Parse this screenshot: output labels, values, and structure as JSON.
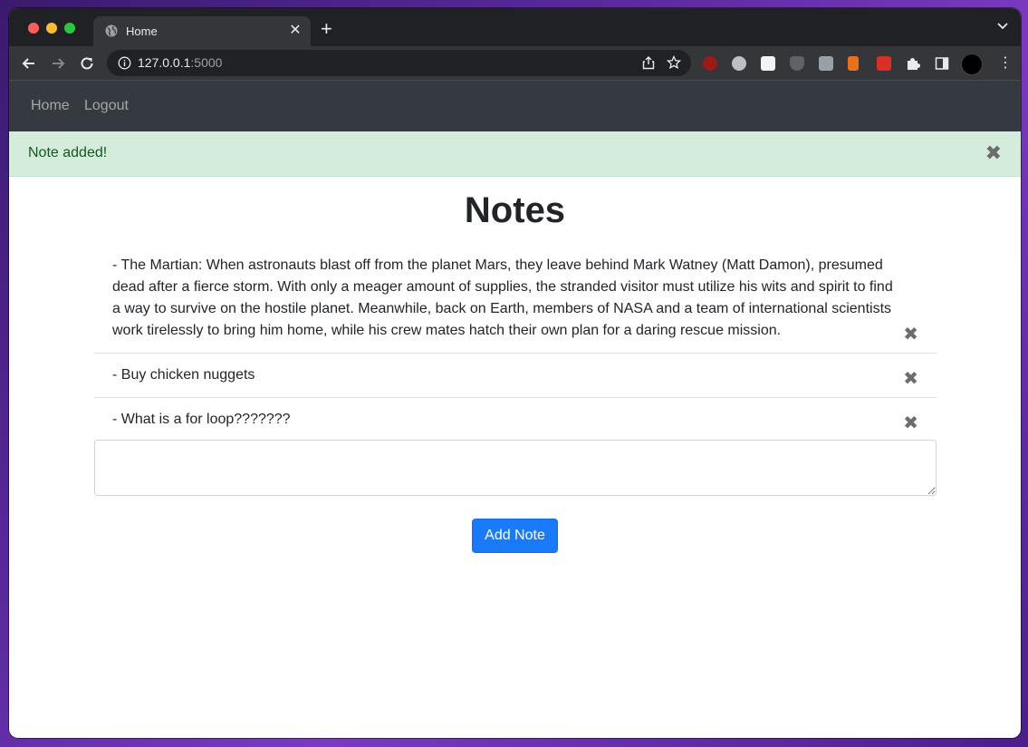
{
  "browser": {
    "tab_title": "Home",
    "url_host": "127.0.0.1",
    "url_port": ":5000"
  },
  "navbar": {
    "home_label": "Home",
    "logout_label": "Logout"
  },
  "alert": {
    "message": "Note added!",
    "close_glyph": "✖"
  },
  "page": {
    "title": "Notes",
    "add_button_label": "Add Note",
    "delete_glyph": "✖"
  },
  "notes": [
    {
      "text": "- The Martian: When astronauts blast off from the planet Mars, they leave behind Mark Watney (Matt Damon), presumed dead after a fierce storm. With only a meager amount of supplies, the stranded visitor must utilize his wits and spirit to find a way to survive on the hostile planet. Meanwhile, back on Earth, members of NASA and a team of international scientists work tirelessly to bring him home, while his crew mates hatch their own plan for a daring rescue mission."
    },
    {
      "text": "- Buy chicken nuggets"
    },
    {
      "text": "- What is a for loop???????"
    }
  ],
  "colors": {
    "navbar_bg": "#343a40",
    "alert_bg": "#d4edda",
    "alert_text": "#155724",
    "primary": "#1a7bfa"
  },
  "icons": [
    "globe-icon",
    "close-icon",
    "plus-icon",
    "chevron-down-icon",
    "back-arrow-icon",
    "forward-arrow-icon",
    "reload-icon",
    "info-icon",
    "share-icon",
    "star-icon",
    "puzzle-icon",
    "sidebar-icon",
    "kebab-menu-icon"
  ]
}
